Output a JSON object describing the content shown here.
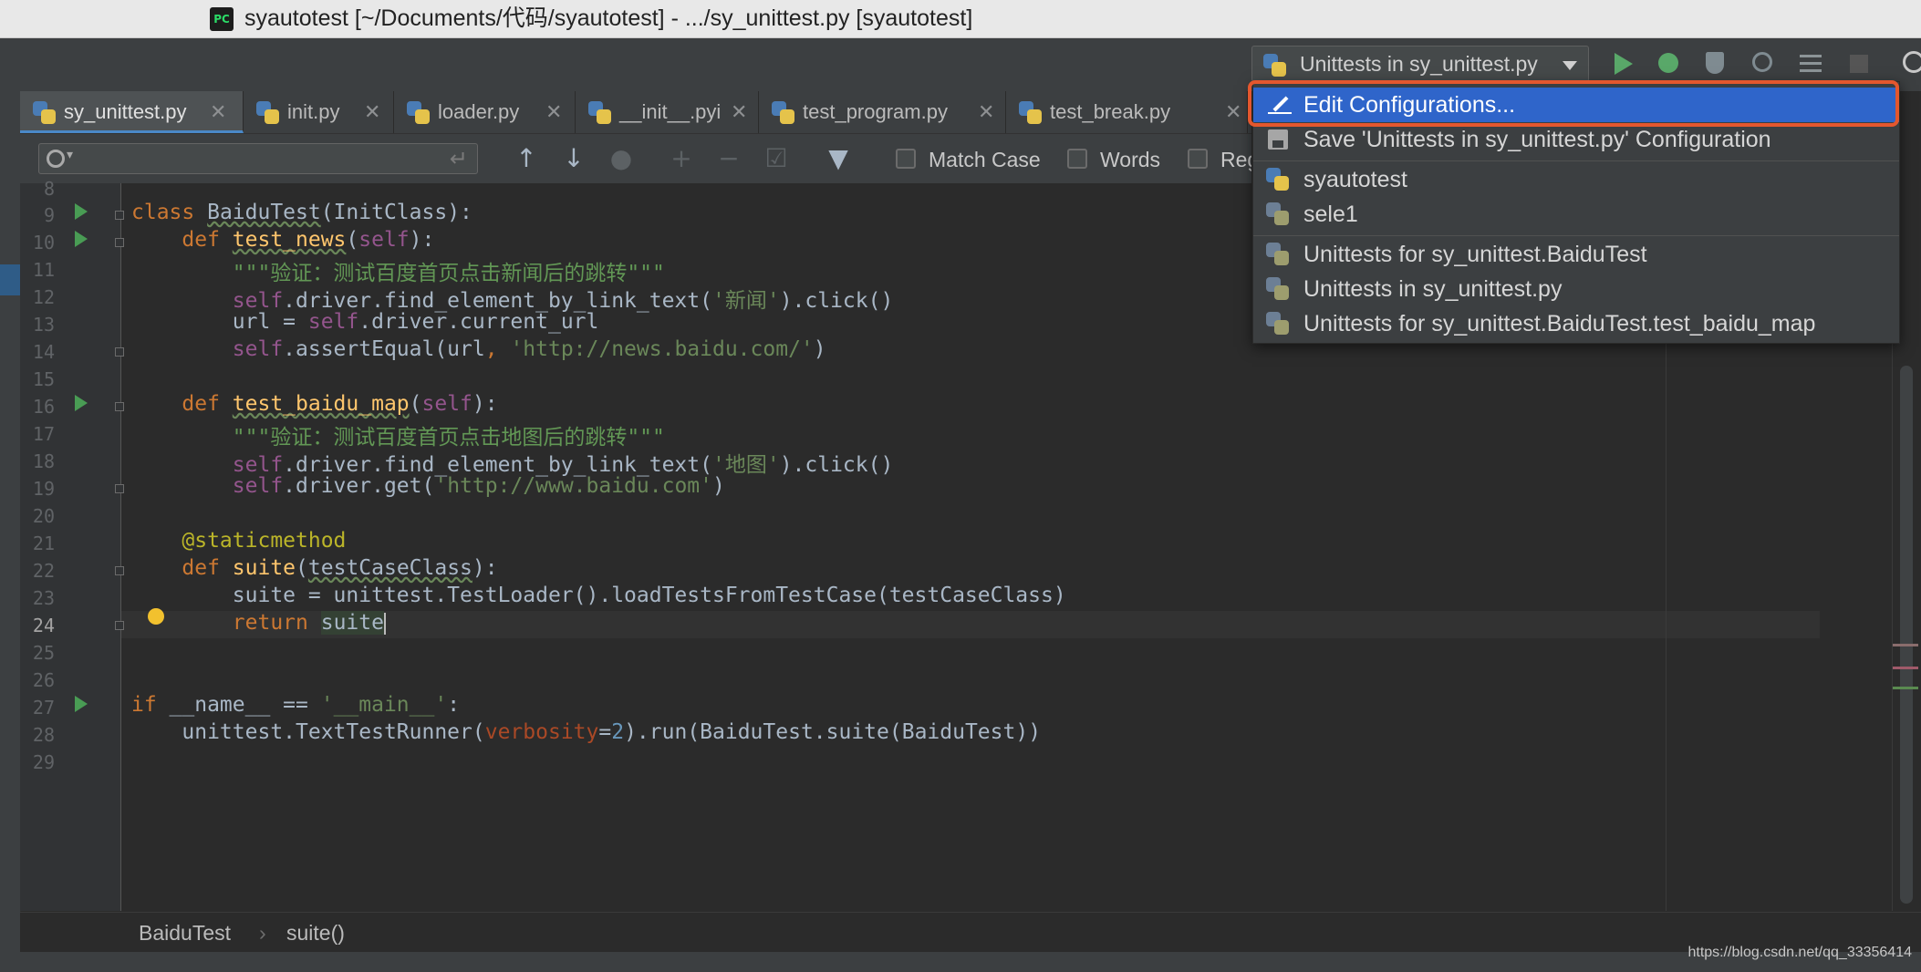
{
  "window": {
    "title": "syautotest [~/Documents/代码/syautotest] - .../sy_unittest.py [syautotest]",
    "app_icon": "PC"
  },
  "toolbar": {
    "run_config_label": "Unittests in sy_unittest.py",
    "buttons": [
      "run-icon",
      "debug-icon",
      "coverage-icon",
      "profile-icon",
      "concurrency-icon",
      "stop-icon",
      "search-icon"
    ]
  },
  "tabs": [
    {
      "label": "sy_unittest.py",
      "active": true
    },
    {
      "label": "init.py"
    },
    {
      "label": "loader.py"
    },
    {
      "label": "__init__.pyi"
    },
    {
      "label": "test_program.py"
    },
    {
      "label": "test_break.py"
    }
  ],
  "search": {
    "value": "",
    "match_case": "Match Case",
    "words": "Words",
    "regex": "Regex"
  },
  "editor": {
    "line_numbers": [
      "8",
      "9",
      "10",
      "11",
      "12",
      "13",
      "14",
      "15",
      "16",
      "17",
      "18",
      "19",
      "20",
      "21",
      "22",
      "23",
      "24",
      "25",
      "26",
      "27",
      "28",
      "29"
    ],
    "current_line": "24"
  },
  "breadcrumb": {
    "class": "BaiduTest",
    "sep": "›",
    "method": "suite()"
  },
  "popup": {
    "edit": "Edit Configurations...",
    "save": "Save 'Unittests in sy_unittest.py' Configuration",
    "configs": [
      "syautotest",
      "sele1"
    ],
    "tests": [
      "Unittests for sy_unittest.BaiduTest",
      "Unittests in sy_unittest.py",
      "Unittests for sy_unittest.BaiduTest.test_baidu_map"
    ]
  },
  "watermark": "https://blog.csdn.net/qq_33356414",
  "colors": {
    "accent": "#2f65ca",
    "highlight": "#e4572e",
    "run": "#59a869"
  }
}
